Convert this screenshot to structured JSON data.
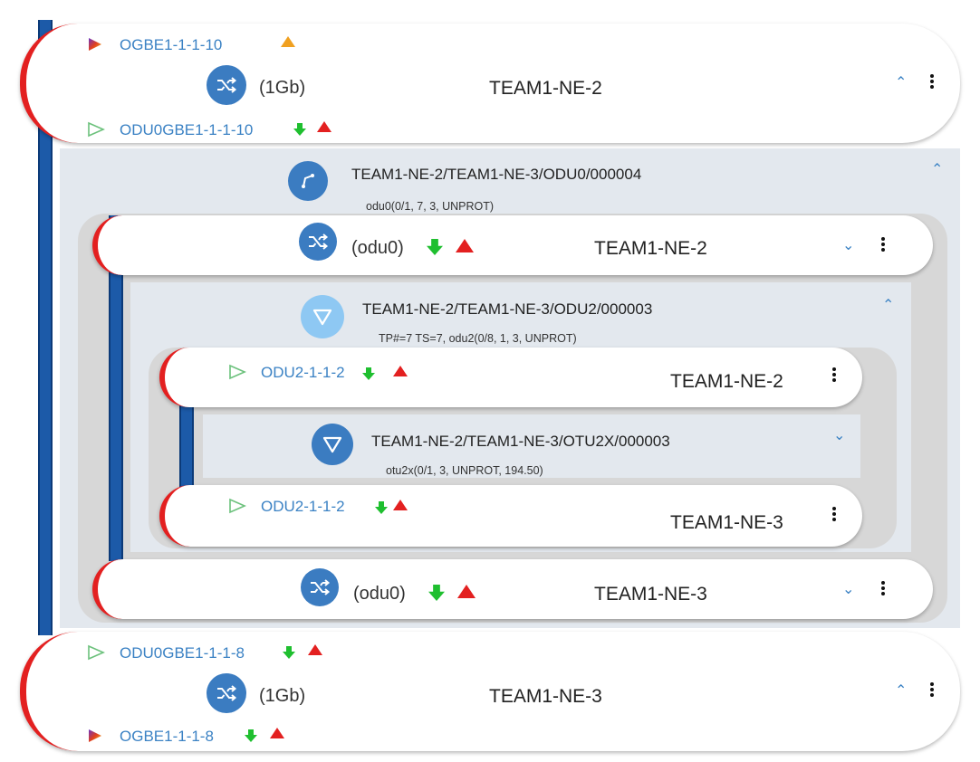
{
  "colors": {
    "accent_blue": "#3b7cc1",
    "link_blue": "#3b82c4",
    "alarm_red": "#e32020",
    "ok_green": "#1fbf2f",
    "warn_orange": "#f0a020",
    "rail_blue": "#1c5aa8"
  },
  "top_node": {
    "port_label": "OGBE1-1-1-10",
    "rate": "(1Gb)",
    "ne": "TEAM1-NE-2",
    "sub_port_label": "ODU0GBE1-1-1-10",
    "expand_icon": "chevron-up-icon"
  },
  "odu0_connection": {
    "path": "TEAM1-NE-2/TEAM1-NE-3/ODU0/000004",
    "details": "odu0(0/1, 7, 3, UNPROT)",
    "node_a": {
      "rate": "(odu0)",
      "ne": "TEAM1-NE-2"
    },
    "node_b": {
      "rate": "(odu0)",
      "ne": "TEAM1-NE-3"
    }
  },
  "odu2_connection": {
    "path": "TEAM1-NE-2/TEAM1-NE-3/ODU2/000003",
    "details": "TP#=7 TS=7, odu2(0/8, 1, 3, UNPROT)",
    "node_a": {
      "port_label": "ODU2-1-1-2",
      "ne": "TEAM1-NE-2"
    },
    "node_b": {
      "port_label": "ODU2-1-1-2",
      "ne": "TEAM1-NE-3"
    }
  },
  "otu2x_connection": {
    "path": "TEAM1-NE-2/TEAM1-NE-3/OTU2X/000003",
    "details": "otu2x(0/1, 3, UNPROT, 194.50)"
  },
  "bottom_node": {
    "sub_port_label": "ODU0GBE1-1-1-8",
    "rate": "(1Gb)",
    "ne": "TEAM1-NE-3",
    "port_label": "OGBE1-1-1-8"
  }
}
